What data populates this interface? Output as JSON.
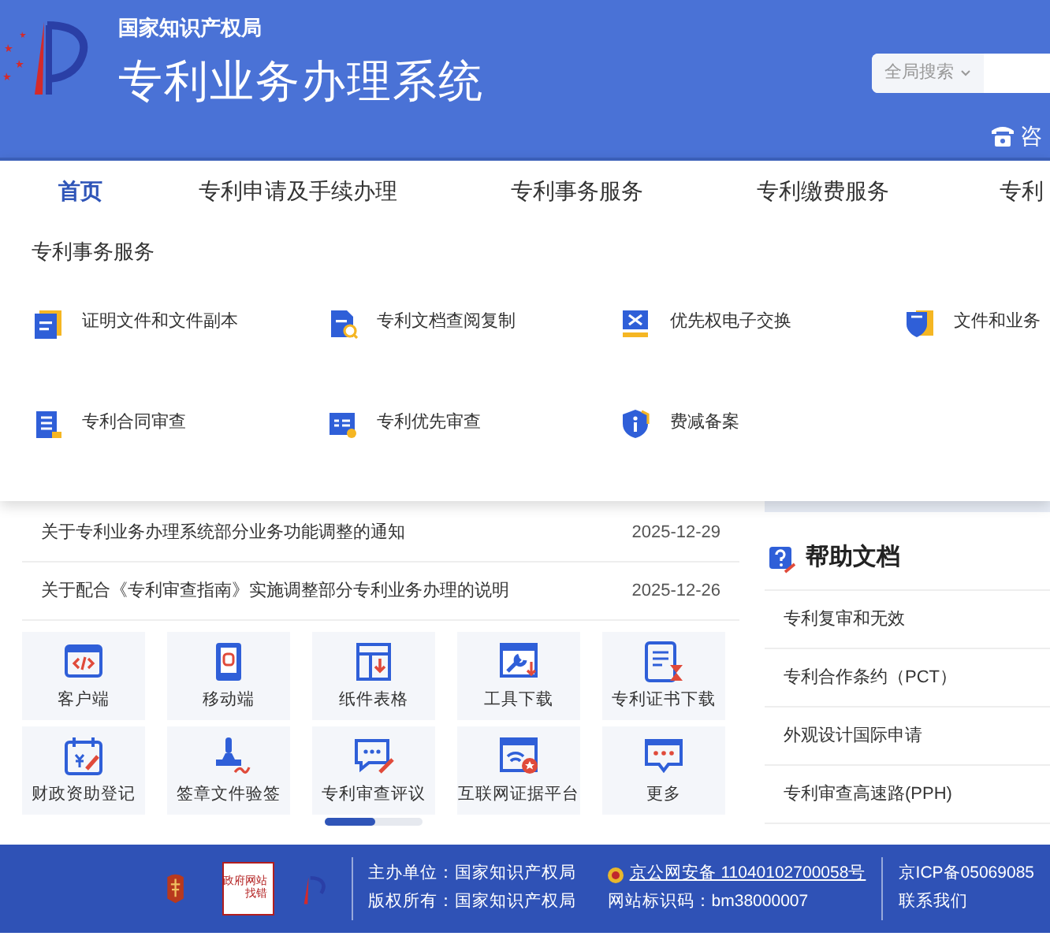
{
  "header": {
    "agency": "国家知识产权局",
    "system_title": "专利业务办理系统",
    "search": {
      "scope": "全局搜索"
    },
    "consult": "咨"
  },
  "nav": [
    {
      "label": "首页",
      "selected": true
    },
    {
      "label": "专利申请及手续办理",
      "selected": false
    },
    {
      "label": "专利事务服务",
      "selected": false
    },
    {
      "label": "专利缴费服务",
      "selected": false
    },
    {
      "label": "专利",
      "selected": false
    }
  ],
  "menu": {
    "heading": "专利事务服务",
    "items": [
      {
        "label": "证明文件和文件副本"
      },
      {
        "label": "专利文档查阅复制"
      },
      {
        "label": "优先权电子交换"
      },
      {
        "label": "文件和业务"
      },
      {
        "label": "专利合同审查"
      },
      {
        "label": "专利优先审查"
      },
      {
        "label": "费减备案"
      }
    ]
  },
  "notices": [
    {
      "title": "关于专利业务办理系统部分业务功能调整的通知",
      "date": "2025-12-29"
    },
    {
      "title": "关于配合《专利审查指南》实施调整部分专利业务办理的说明",
      "date": "2025-12-26"
    }
  ],
  "tiles": [
    {
      "label": "客户端"
    },
    {
      "label": "移动端"
    },
    {
      "label": "纸件表格"
    },
    {
      "label": "工具下载"
    },
    {
      "label": "专利证书下载"
    },
    {
      "label": "财政资助登记"
    },
    {
      "label": "签章文件验签"
    },
    {
      "label": "专利审查评议"
    },
    {
      "label": "互联网证据平台"
    },
    {
      "label": "更多"
    }
  ],
  "help": {
    "title": "帮助文档",
    "links": [
      "专利复审和无效",
      "专利合作条约（PCT）",
      "外观设计国际申请",
      "专利审查高速路(PPH)"
    ]
  },
  "footer": {
    "badge": [
      "政府网站",
      "找错"
    ],
    "columns": [
      {
        "line1": "主办单位：国家知识产权局",
        "line2": "版权所有：国家知识产权局"
      },
      {
        "line1": "京公网安备 11040102700058号",
        "line2": "网站标识码：bm38000007"
      },
      {
        "line1": "京ICP备05069085",
        "line2": "联系我们"
      }
    ]
  }
}
